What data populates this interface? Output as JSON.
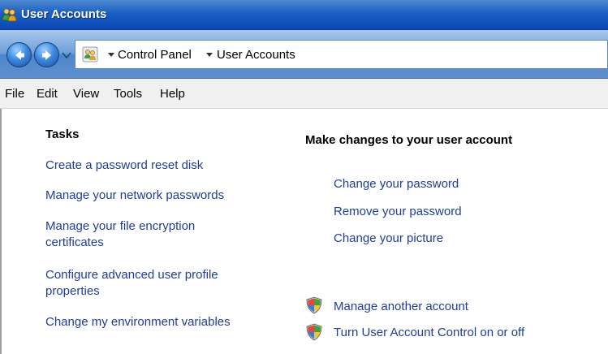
{
  "window": {
    "title": "User Accounts",
    "icon": "users-icon"
  },
  "address": {
    "breadcrumbs": [
      "Control Panel",
      "User Accounts"
    ],
    "icon": "control-panel-users-icon"
  },
  "menu": {
    "items": [
      "File",
      "Edit",
      "View",
      "Tools",
      "Help"
    ]
  },
  "tasks": {
    "heading": "Tasks",
    "links": [
      [
        "Create a password reset disk"
      ],
      [
        "Manage your network passwords"
      ],
      [
        "Manage your file encryption",
        "certificates"
      ],
      [
        "Configure advanced user profile",
        "properties"
      ],
      [
        "Change my environment variables"
      ]
    ]
  },
  "main": {
    "heading": "Make changes to your user account",
    "links": [
      "Change your password",
      "Remove your password",
      "Change your picture"
    ],
    "admin_links": [
      "Manage another account",
      "Turn User Account Control on or off"
    ],
    "admin_icon": "uac-shield-icon"
  },
  "colors": {
    "link": "#1f3e94",
    "titlebar": "#1b5fc4"
  }
}
